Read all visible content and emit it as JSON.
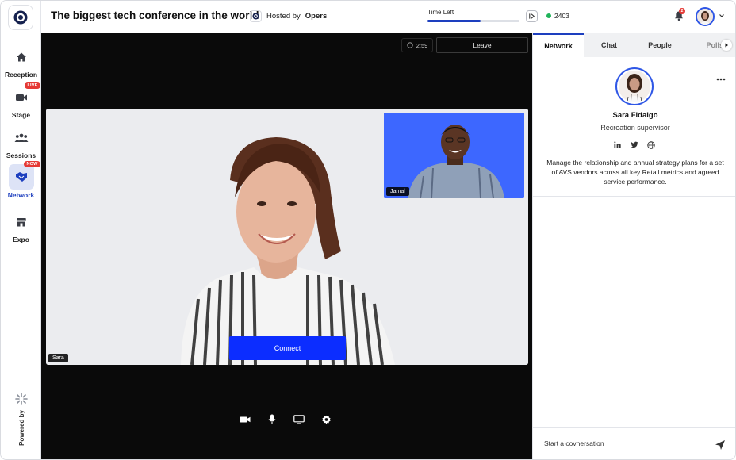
{
  "app": {
    "title": "The biggest tech conference in the world",
    "hosted_by_prefix": "Hosted by",
    "host_name": "Opers"
  },
  "rail": {
    "items": [
      {
        "label": "Reception",
        "icon": "home-icon",
        "badge": ""
      },
      {
        "label": "Stage",
        "icon": "video-camera-icon",
        "badge": "LIVE"
      },
      {
        "label": "Sessions",
        "icon": "people-group-icon",
        "badge": ""
      },
      {
        "label": "Network",
        "icon": "handshake-icon",
        "badge": "NOW",
        "active": true
      },
      {
        "label": "Expo",
        "icon": "store-icon",
        "badge": ""
      }
    ],
    "powered_by": "Powered by"
  },
  "header": {
    "time_left_label": "Time Left",
    "time_left_progress": 0.58,
    "online_count": "2403",
    "notification_count": "2"
  },
  "stage": {
    "timer": "2:59",
    "leave_label": "Leave",
    "main_speaker": "Sara",
    "pip_speaker": "Jamal",
    "connect_label": "Connect",
    "controls": [
      "camera-icon",
      "microphone-icon",
      "screen-share-icon",
      "settings-gear-icon"
    ]
  },
  "panel": {
    "tabs": [
      "Network",
      "Chat",
      "People",
      "Polls"
    ],
    "active_tab": "Network",
    "profile": {
      "name": "Sara Fidalgo",
      "role": "Recreation supervisor",
      "bio": "Manage the relationship and annual strategy plans for a set of AVS vendors across all key Retail metrics and agreed service performance.",
      "socials": [
        "linkedin-icon",
        "twitter-icon",
        "globe-icon"
      ]
    },
    "chat_placeholder": "Start a covnersation"
  },
  "colors": {
    "accent": "#1d3fbf",
    "connect": "#0c2dff",
    "live_badge": "#e53935",
    "online": "#1fb35a",
    "pip_bg": "#3d67ff"
  }
}
